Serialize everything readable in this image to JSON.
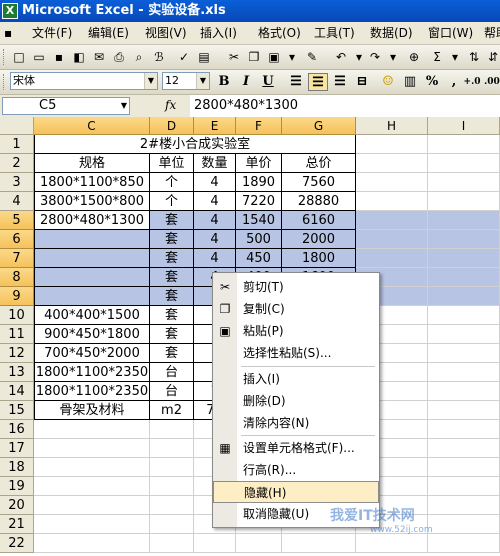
{
  "title": "Microsoft Excel - 实验设备.xls",
  "menu": [
    "文件(F)",
    "编辑(E)",
    "视图(V)",
    "插入(I)",
    "格式(O)",
    "工具(T)",
    "数据(D)",
    "窗口(W)",
    "帮助"
  ],
  "format_bar": {
    "font": "宋体",
    "size": "12",
    "bold": "B",
    "italic": "I",
    "underline": "U"
  },
  "formula_bar": {
    "name_box": "C5",
    "fx": "fx",
    "formula": "2800*480*1300"
  },
  "columns": [
    "C",
    "D",
    "E",
    "F",
    "G",
    "H",
    "I"
  ],
  "rows": [
    {
      "num": "1",
      "cells": [
        "2#楼小合成实验室"
      ]
    },
    {
      "num": "2",
      "cells": [
        "规格",
        "单位",
        "数量",
        "单价",
        "总价"
      ]
    },
    {
      "num": "3",
      "cells": [
        "1800*1100*850",
        "个",
        "4",
        "1890",
        "7560"
      ]
    },
    {
      "num": "4",
      "cells": [
        "3800*1500*800",
        "个",
        "4",
        "7220",
        "28880"
      ]
    },
    {
      "num": "5",
      "cells": [
        "2800*480*1300",
        "套",
        "4",
        "1540",
        "6160"
      ]
    },
    {
      "num": "6",
      "cells": [
        "",
        "套",
        "4",
        "500",
        "2000"
      ]
    },
    {
      "num": "7",
      "cells": [
        "",
        "套",
        "4",
        "450",
        "1800"
      ]
    },
    {
      "num": "8",
      "cells": [
        "",
        "套",
        "4",
        "400",
        "1600"
      ]
    },
    {
      "num": "9",
      "cells": [
        "",
        "套",
        "",
        "",
        ""
      ]
    },
    {
      "num": "10",
      "cells": [
        "400*400*1500",
        "套",
        "",
        "",
        ""
      ]
    },
    {
      "num": "11",
      "cells": [
        "900*450*1800",
        "套",
        "",
        "",
        ""
      ]
    },
    {
      "num": "12",
      "cells": [
        "700*450*2000",
        "套",
        "",
        "",
        ""
      ]
    },
    {
      "num": "13",
      "cells": [
        "1800*1100*2350",
        "台",
        "",
        "",
        ""
      ]
    },
    {
      "num": "14",
      "cells": [
        "1800*1100*2350",
        "台",
        "1",
        "",
        ""
      ]
    },
    {
      "num": "15",
      "cells": [
        "骨架及材料",
        "m2",
        "77",
        "",
        ""
      ]
    },
    {
      "num": "16",
      "cells": []
    },
    {
      "num": "17",
      "cells": []
    },
    {
      "num": "18",
      "cells": []
    },
    {
      "num": "19",
      "cells": []
    },
    {
      "num": "20",
      "cells": []
    },
    {
      "num": "21",
      "cells": []
    },
    {
      "num": "22",
      "cells": []
    }
  ],
  "context_menu": [
    {
      "label": "剪切(T)",
      "icon": "scissors-icon"
    },
    {
      "label": "复制(C)",
      "icon": "copy-icon"
    },
    {
      "label": "粘贴(P)",
      "icon": "paste-icon"
    },
    {
      "label": "选择性粘贴(S)..."
    },
    {
      "label": "插入(I)"
    },
    {
      "label": "删除(D)"
    },
    {
      "label": "清除内容(N)"
    },
    {
      "label": "设置单元格格式(F)...",
      "icon": "format-cells-icon"
    },
    {
      "label": "行高(R)..."
    },
    {
      "label": "隐藏(H)"
    },
    {
      "label": "取消隐藏(U)"
    }
  ],
  "watermark": {
    "text": "我爱IT技术网",
    "url": "www.52ij.com"
  },
  "colors": {
    "selection": "#b7c4e3",
    "header_selected": "#f5c25a",
    "title_bar": "#0a5fd8",
    "menu_highlight": "#fdeec6"
  }
}
